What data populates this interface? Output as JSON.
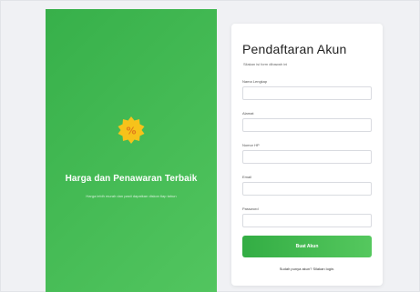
{
  "promo": {
    "badge_icon": "percent-badge-icon",
    "badge_color": "#f7c21a",
    "title": "Harga dan Penawaran Terbaik",
    "subtitle": "Harga lebih murah dan pasti dapatkan diskon tiap tahun"
  },
  "form": {
    "title": "Pendaftaran Akun",
    "subtitle": "Silakan isi form dibawah ini",
    "fields": [
      {
        "label": "Nama Lengkap",
        "value": "",
        "placeholder": ""
      },
      {
        "label": "Alamat",
        "value": "",
        "placeholder": ""
      },
      {
        "label": "Nomor HP",
        "value": "",
        "placeholder": ""
      },
      {
        "label": "Email",
        "value": "",
        "placeholder": ""
      },
      {
        "label": "Password",
        "value": "",
        "placeholder": ""
      }
    ],
    "submit_label": "Buat Akun",
    "login_note": "Sudah punya akun? Silakan login."
  },
  "colors": {
    "accent_green": "#3fb84f",
    "background": "#f0f1f4"
  }
}
